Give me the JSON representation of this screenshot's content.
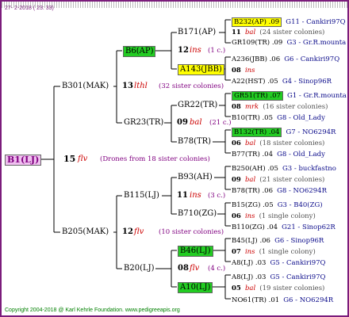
{
  "header_date": "27-  2-2018 ( 23: 33)",
  "root": {
    "id": "B1(LJ)",
    "num": "15",
    "race": "flv",
    "note": "(Drones from 18 sister colonies)"
  },
  "g1": [
    {
      "id": "B301(MAK)",
      "num": "13",
      "race": "lthl",
      "note": "(32 sister colonies)"
    },
    {
      "id": "B205(MAK)",
      "num": "12",
      "race": "flv",
      "note": "(10 sister colonies)"
    }
  ],
  "g2": [
    {
      "id": "B6(AP)",
      "num": "",
      "race": "",
      "note": ""
    },
    {
      "id": "GR23(TR)",
      "num": "09",
      "race": "bal",
      "note": "(21 c.)"
    },
    {
      "id": "B115(LJ)",
      "num": "11",
      "race": "ins",
      "note": "(3 c.)"
    },
    {
      "id": "B20(LJ)",
      "num": "",
      "race": "",
      "note": ""
    }
  ],
  "g3": [
    {
      "id": "B171(AP)",
      "num": "12",
      "race": "ins",
      "note": "(1 c.)"
    },
    {
      "id": "A143(JBB)",
      "num": "",
      "race": "",
      "note": ""
    },
    {
      "id": "GR22(TR)",
      "num": "",
      "race": "",
      "note": ""
    },
    {
      "id": "B78(TR)",
      "num": "",
      "race": "",
      "note": ""
    },
    {
      "id": "B93(AH)",
      "num": "",
      "race": "",
      "note": ""
    },
    {
      "id": "B710(ZG)",
      "num": "",
      "race": "",
      "note": ""
    },
    {
      "id": "B46(LJ)",
      "num": "08",
      "race": "flv",
      "note": "(4 c.)"
    },
    {
      "id": "A10(LJ)",
      "num": "",
      "race": "",
      "note": ""
    }
  ],
  "g4": [
    {
      "a": "B232(AP) .09",
      "b": "G11 - Cankiri97Q",
      "n": "11",
      "r": "bal",
      "note": "(24 sister colonies)",
      "c": "GR109(TR) .09",
      "d": "G3 - Gr.R.mounta"
    },
    {
      "a": "A236(JBB) .06",
      "b": "G6 - Cankiri97Q",
      "n": "08",
      "r": "ins",
      "note": "",
      "c": "A22(HST) .05",
      "d": "G4 - Sinop96R"
    },
    {
      "a": "GR51(TR) .07",
      "b": "G1 - Gr.R.mounta",
      "n": "08",
      "r": "mrk",
      "note": "(16 sister colonies)",
      "c": "B10(TR) .05",
      "d": "G8 - Old_Lady"
    },
    {
      "a": "B132(TR) .04",
      "b": "G7 - NO6294R",
      "n": "06",
      "r": "bal",
      "note": "(18 sister colonies)",
      "c": "B77(TR) .04",
      "d": "G8 - Old_Lady"
    },
    {
      "a": "B250(AH) .05",
      "b": "G3 - buckfastno",
      "n": "09",
      "r": "bal",
      "note": "(21 sister colonies)",
      "c": "B78(TR) .06",
      "d": "G8 - NO6294R"
    },
    {
      "a": "B15(ZG) .05",
      "b": "G3 - B40(ZG)",
      "n": "06",
      "r": "ins",
      "note": "(1 single colony)",
      "c": "B110(ZG) .04",
      "d": "G21 - Sinop62R"
    },
    {
      "a": "B45(LJ) .06",
      "b": "G6 - Sinop96R",
      "n": "07",
      "r": "ins",
      "note": "(1 single colony)",
      "c": "A8(LJ) .03",
      "d": "G5 - Cankiri97Q"
    },
    {
      "a": "A8(LJ) .03",
      "b": "G5 - Cankiri97Q",
      "n": "05",
      "r": "bal",
      "note": "(19 sister colonies)",
      "c": "NO61(TR) .01",
      "d": "G6 - NO6294R"
    }
  ],
  "footer": "Copyright 2004-2018 @ Karl Kehrle Foundation.   www.pedigreeapis.org",
  "colors": {
    "frame": "#7b1c7b",
    "yellow": "#ffff00",
    "green": "#22cc22",
    "pink": "#f0c0f0",
    "race": "#cc0000"
  }
}
